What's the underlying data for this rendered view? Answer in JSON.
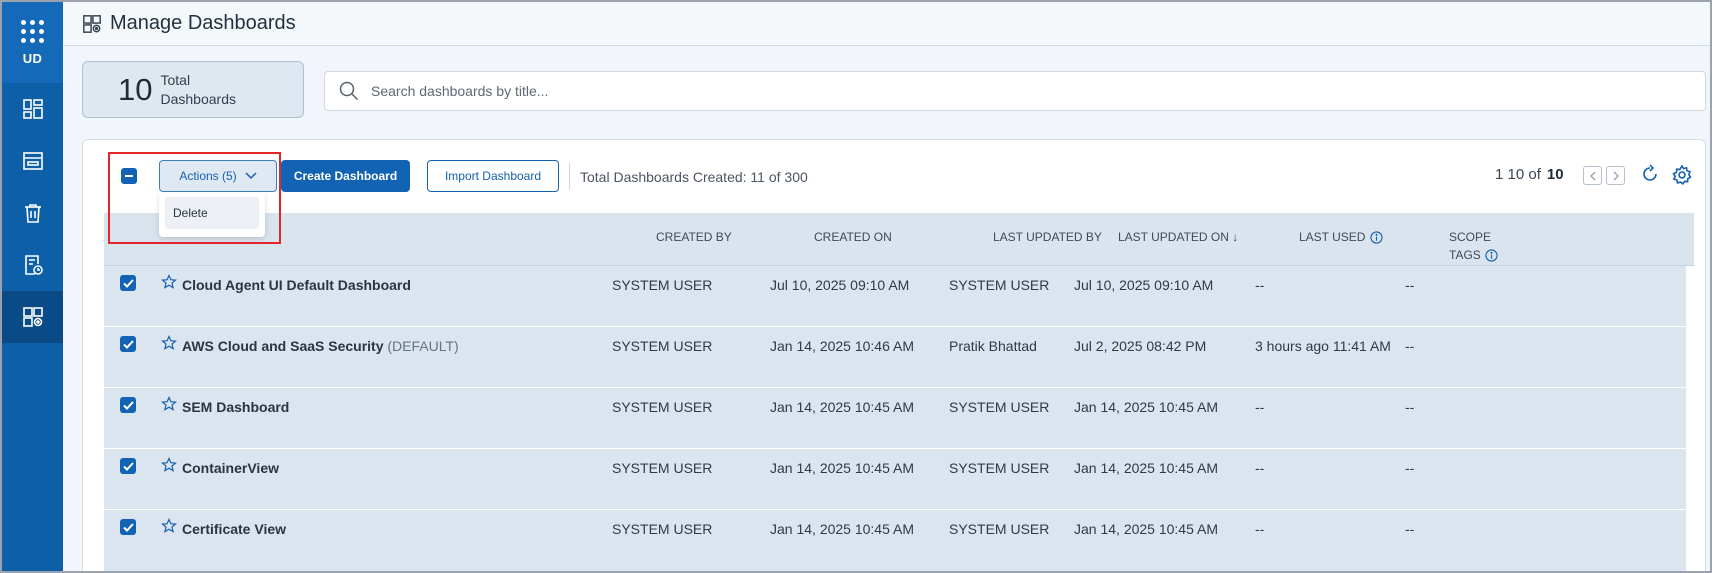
{
  "rail": {
    "apps_label": "UD",
    "items": [
      {
        "icon": "dashboard-grid-icon",
        "active": false
      },
      {
        "icon": "widget-panel-icon",
        "active": false
      },
      {
        "icon": "trash-icon",
        "active": false
      },
      {
        "icon": "report-clock-icon",
        "active": false
      },
      {
        "icon": "manage-dashboards-icon",
        "active": true
      }
    ]
  },
  "header": {
    "title": "Manage Dashboards",
    "icon": "manage-dashboards-icon"
  },
  "summary": {
    "count": "10",
    "label": "Total Dashboards"
  },
  "search": {
    "placeholder": "Search dashboards by title..."
  },
  "toolbar": {
    "actions_label": "Actions (5)",
    "create_label": "Create Dashboard",
    "import_label": "Import Dashboard",
    "total_created": "Total Dashboards Created: 11 of 300",
    "pager_range": "1 10 of",
    "pager_total": "10"
  },
  "actions_menu": {
    "items": [
      "Delete"
    ]
  },
  "table": {
    "columns": {
      "created_by": "CREATED BY",
      "created_on": "CREATED ON",
      "last_updated_by": "LAST UPDATED BY",
      "last_updated_on": "LAST UPDATED ON ↓",
      "last_used": "LAST USED",
      "scope_tags_1": "SCOPE",
      "scope_tags_2": "TAGS"
    },
    "rows": [
      {
        "name": "Cloud Agent UI Default Dashboard",
        "tag": "",
        "created_by": "SYSTEM USER",
        "created_on": "Jul 10, 2025 09:10 AM",
        "last_updated_by": "SYSTEM USER",
        "last_updated_on": "Jul 10, 2025 09:10 AM",
        "last_used": "--",
        "scope_tags": "--"
      },
      {
        "name": "AWS Cloud and SaaS Security",
        "tag": "(DEFAULT)",
        "created_by": "SYSTEM USER",
        "created_on": "Jan 14, 2025 10:46 AM",
        "last_updated_by": "Pratik Bhattad",
        "last_updated_on": "Jul 2, 2025 08:42 PM",
        "last_used": "3 hours ago 11:41 AM",
        "scope_tags": "--"
      },
      {
        "name": "SEM Dashboard",
        "tag": "",
        "created_by": "SYSTEM USER",
        "created_on": "Jan 14, 2025 10:45 AM",
        "last_updated_by": "SYSTEM USER",
        "last_updated_on": "Jan 14, 2025 10:45 AM",
        "last_used": "--",
        "scope_tags": "--"
      },
      {
        "name": "ContainerView",
        "tag": "",
        "created_by": "SYSTEM USER",
        "created_on": "Jan 14, 2025 10:45 AM",
        "last_updated_by": "SYSTEM USER",
        "last_updated_on": "Jan 14, 2025 10:45 AM",
        "last_used": "--",
        "scope_tags": "--"
      },
      {
        "name": "Certificate View",
        "tag": "",
        "created_by": "SYSTEM USER",
        "created_on": "Jan 14, 2025 10:45 AM",
        "last_updated_by": "SYSTEM USER",
        "last_updated_on": "Jan 14, 2025 10:45 AM",
        "last_used": "--",
        "scope_tags": "--"
      }
    ]
  },
  "colors": {
    "brand": "#1363b4",
    "rail": "#0d5fa8",
    "row_bg": "#dbe5ef",
    "highlight": "#e3262b"
  }
}
